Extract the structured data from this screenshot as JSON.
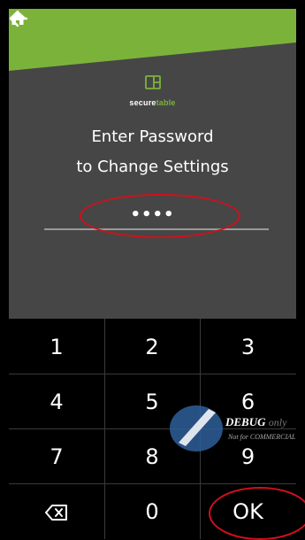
{
  "colors": {
    "accent": "#7bb33a",
    "background": "#464646",
    "keypad": "#000000",
    "annotation": "#d0101b"
  },
  "header": {
    "back_icon": "arrow-left-icon",
    "home_icon": "home-icon"
  },
  "logo": {
    "prefix": "secure",
    "suffix": "table",
    "icon": "table-card-icon"
  },
  "prompt": {
    "line1": "Enter Password",
    "line2": "to Change Settings"
  },
  "password": {
    "value": "••••"
  },
  "keypad": {
    "keys": [
      "1",
      "2",
      "3",
      "4",
      "5",
      "6",
      "7",
      "8",
      "9",
      "0"
    ],
    "backspace_icon": "backspace-icon",
    "ok_label": "OK"
  },
  "watermark": {
    "debug": "DEBUG",
    "only": "only",
    "notice": "Not for COMMERCIAL"
  }
}
